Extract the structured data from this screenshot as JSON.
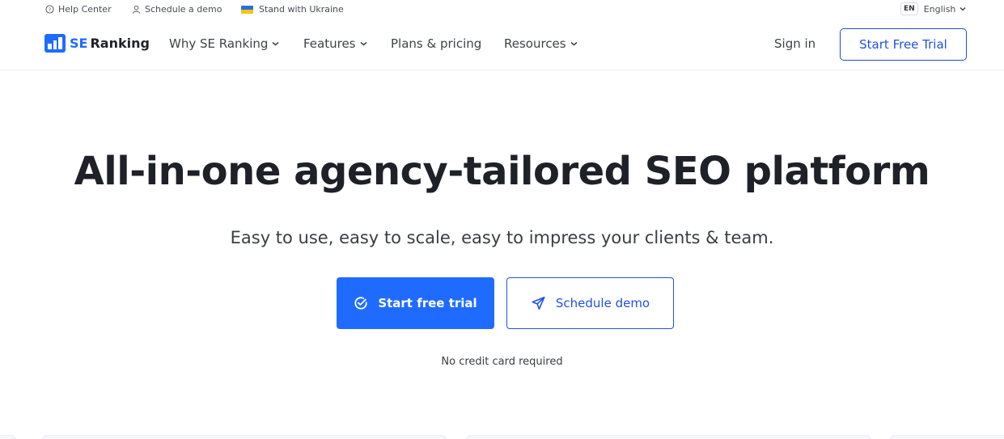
{
  "topbar": {
    "help_center": "Help Center",
    "schedule_demo": "Schedule a demo",
    "ukraine": "Stand with Ukraine",
    "lang_code": "EN",
    "lang_label": "English"
  },
  "nav": {
    "logo_se": "SE",
    "logo_ranking": "Ranking",
    "items": [
      {
        "label": "Why SE Ranking",
        "dropdown": true
      },
      {
        "label": "Features",
        "dropdown": true
      },
      {
        "label": "Plans & pricing",
        "dropdown": false
      },
      {
        "label": "Resources",
        "dropdown": true
      }
    ],
    "sign_in": "Sign in",
    "start_trial": "Start Free Trial"
  },
  "hero": {
    "title": "All-in-one agency-tailored SEO platform",
    "subtitle": "Easy to use, easy to scale, easy to impress your clients & team.",
    "primary_cta": "Start free trial",
    "secondary_cta": "Schedule demo",
    "note": "No credit card required"
  },
  "colors": {
    "brand": "#1f6bff",
    "link": "#2152e0",
    "text": "#1f2128"
  }
}
